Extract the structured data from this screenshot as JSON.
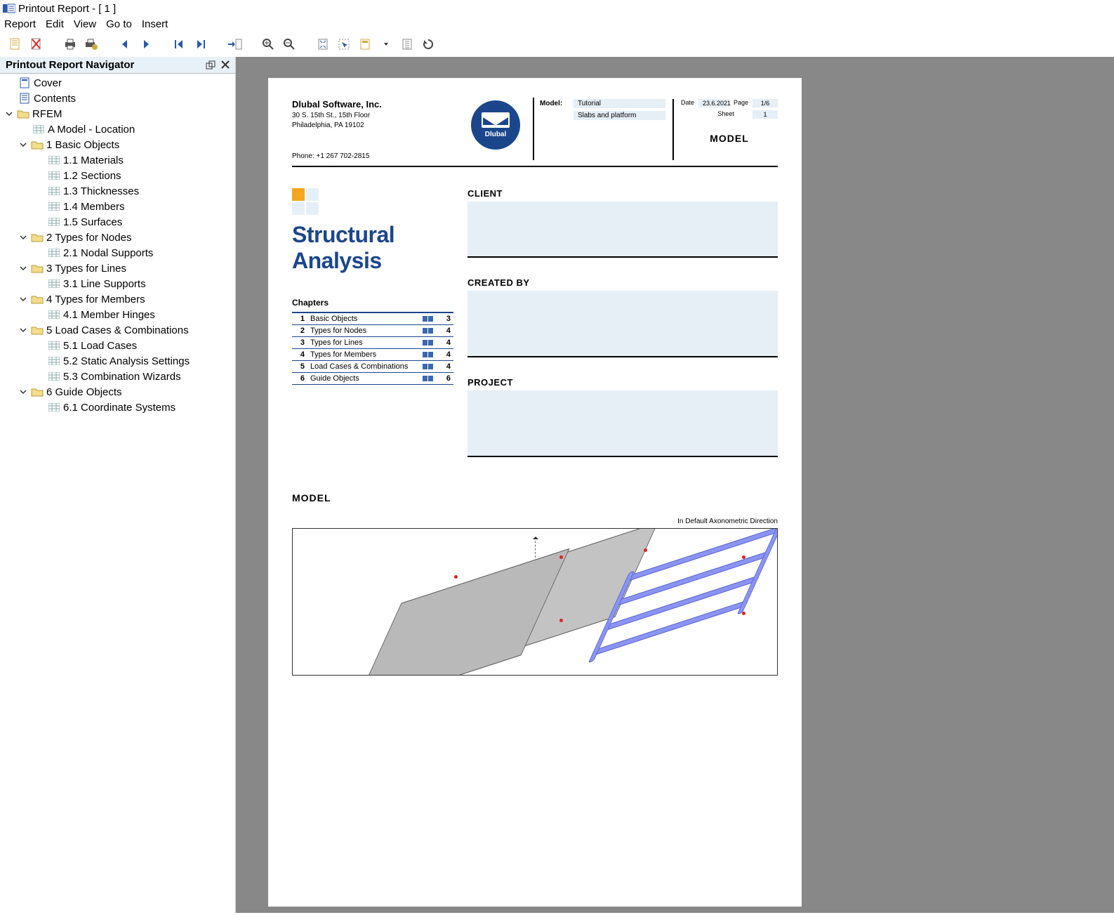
{
  "window": {
    "title": "Printout Report - [ 1 ]"
  },
  "menu": {
    "items": [
      "Report",
      "Edit",
      "View",
      "Go to",
      "Insert"
    ]
  },
  "nav": {
    "title": "Printout Report Navigator",
    "tree": {
      "cover": "Cover",
      "contents": "Contents",
      "rfem": "RFEM",
      "model_loc": "A Model - Location",
      "basic": "1 Basic Objects",
      "b1": "1.1 Materials",
      "b2": "1.2 Sections",
      "b3": "1.3 Thicknesses",
      "b4": "1.4 Members",
      "b5": "1.5 Surfaces",
      "types_nodes": "2 Types for Nodes",
      "tn1": "2.1 Nodal Supports",
      "types_lines": "3 Types for Lines",
      "tl1": "3.1 Line Supports",
      "types_members": "4 Types for Members",
      "tm1": "4.1 Member Hinges",
      "load_comb": "5 Load Cases & Combinations",
      "lc1": "5.1 Load Cases",
      "lc2": "5.2 Static Analysis Settings",
      "lc3": "5.3 Combination Wizards",
      "guide": "6 Guide Objects",
      "g1": "6.1 Coordinate Systems"
    }
  },
  "report": {
    "company": "Dlubal Software, Inc.",
    "addr1": "30 S. 15th St., 15th Floor",
    "addr2": "Philadelphia, PA 19102",
    "phone": "Phone: +1 267 702-2815",
    "logo_text": "Dlubal",
    "model_label": "Model:",
    "model_val": "Tutorial",
    "model_desc": "Slabs and platform",
    "date_label": "Date",
    "date_val": "23.6.2021",
    "page_label": "Page",
    "page_val": "1/6",
    "sheet_label": "Sheet",
    "sheet_val": "1",
    "header_model": "MODEL",
    "title1": "Structural",
    "title2": "Analysis",
    "chapters_head": "Chapters",
    "chapters": [
      {
        "n": "1",
        "name": "Basic Objects",
        "page": "3"
      },
      {
        "n": "2",
        "name": "Types for Nodes",
        "page": "4"
      },
      {
        "n": "3",
        "name": "Types for Lines",
        "page": "4"
      },
      {
        "n": "4",
        "name": "Types for Members",
        "page": "4"
      },
      {
        "n": "5",
        "name": "Load Cases & Combinations",
        "page": "4"
      },
      {
        "n": "6",
        "name": "Guide Objects",
        "page": "6"
      }
    ],
    "sec_client": "CLIENT",
    "sec_created": "CREATED BY",
    "sec_project": "PROJECT",
    "sec_model": "MODEL",
    "axon_note": "In Default Axonometric Direction"
  }
}
